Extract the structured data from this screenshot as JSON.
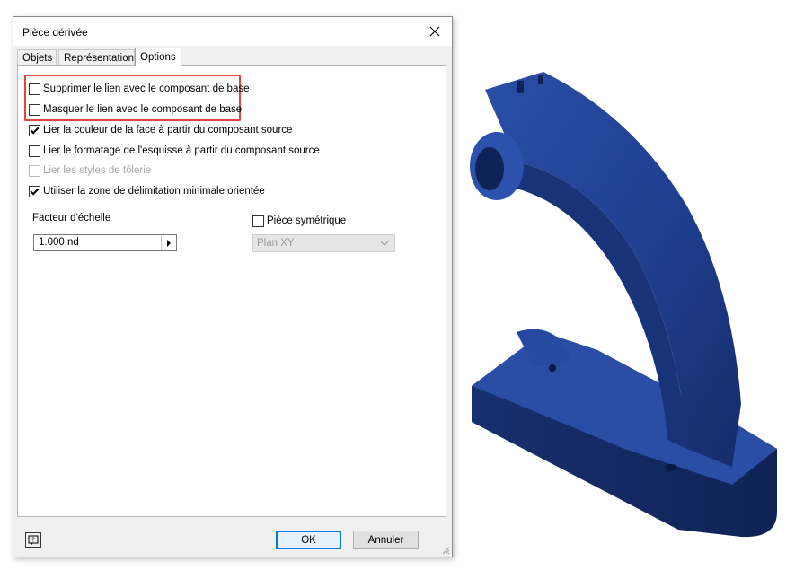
{
  "dialog": {
    "title": "Pièce dérivée",
    "tabs": [
      {
        "label": "Objets",
        "active": false
      },
      {
        "label": "Représentation",
        "active": false
      },
      {
        "label": "Options",
        "active": true
      }
    ],
    "options": [
      {
        "label": "Supprimer le lien avec le composant de base",
        "checked": false,
        "enabled": true
      },
      {
        "label": "Masquer le lien avec le composant de base",
        "checked": false,
        "enabled": true
      },
      {
        "label": "Lier la couleur de la face à partir du composant source",
        "checked": true,
        "enabled": true
      },
      {
        "label": "Lier le formatage de l'esquisse à partir du composant source",
        "checked": false,
        "enabled": true
      },
      {
        "label": "Lier les styles de tôlerie",
        "checked": false,
        "enabled": false
      },
      {
        "label": "Utiliser la zone de délimitation minimale orientée",
        "checked": true,
        "enabled": true
      }
    ],
    "scale": {
      "label": "Facteur d'échelle",
      "value": "1.000 nd"
    },
    "symmetric": {
      "label": "Pièce symétrique",
      "checked": false,
      "plane": "Plan XY"
    },
    "buttons": {
      "ok": "OK",
      "cancel": "Annuler"
    }
  },
  "colors": {
    "highlight": "#e0463c",
    "model_blue": "#1f3f8f",
    "ok_border": "#0078d7"
  }
}
